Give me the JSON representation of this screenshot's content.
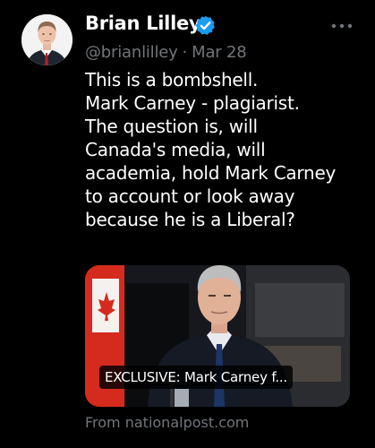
{
  "post": {
    "author": {
      "display_name": "Brian Lilley",
      "handle": "@brianlilley",
      "verified": true,
      "avatar_icon": "profile-photo"
    },
    "separator": "·",
    "date": "Mar 28",
    "more_icon": "more-options-icon",
    "text_lines": [
      "This is a bombshell.",
      "Mark Carney - plagiarist.",
      "The question is, will",
      "Canada's media, will",
      "academia, hold Mark Carney",
      "to account or look away",
      "because he is a Liberal?"
    ],
    "link_card": {
      "title": "EXCLUSIVE: Mark Carney f...",
      "source": "From nationalpost.com"
    }
  },
  "colors": {
    "background": "#000000",
    "primary_text": "#ffffff",
    "secondary_text": "#71767b",
    "verified_badge": "#1d9bf0"
  }
}
